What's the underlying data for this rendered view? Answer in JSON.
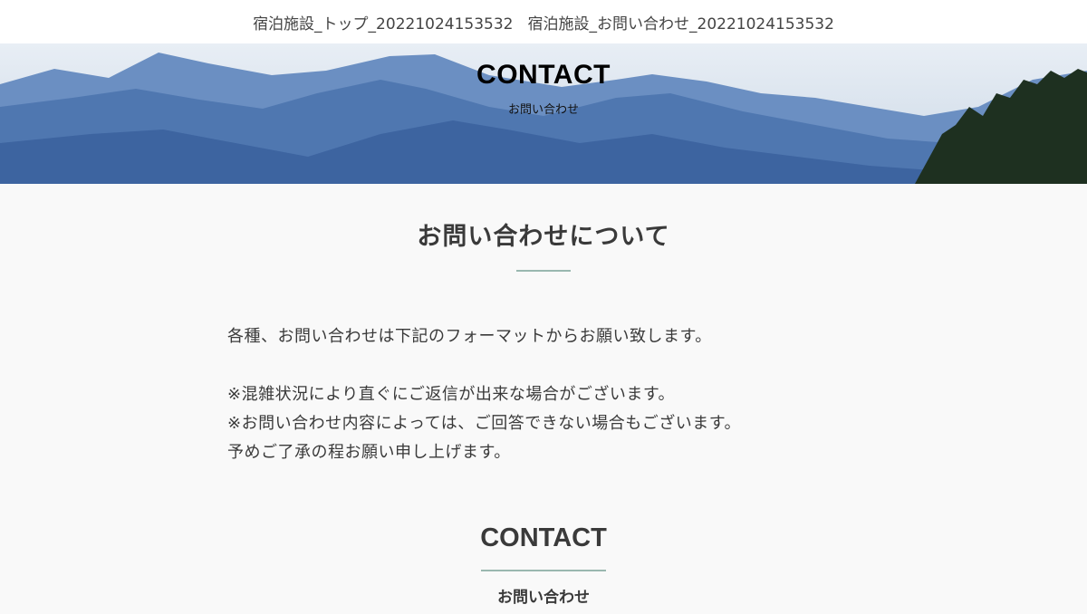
{
  "nav": {
    "items": [
      "宿泊施設_トップ_20221024153532",
      "宿泊施設_お問い合わせ_20221024153532"
    ]
  },
  "hero": {
    "title": "CONTACT",
    "subtitle": "お問い合わせ"
  },
  "about": {
    "title": "お問い合わせについて",
    "lines": [
      "各種、お問い合わせは下記のフォーマットからお願い致します。",
      "※混雑状況により直ぐにご返信が出来な場合がございます。",
      "※お問い合わせ内容によっては、ご回答できない場合もございます。",
      "予めご了承の程お願い申し上げます。"
    ]
  },
  "contact": {
    "title": "CONTACT",
    "subtitle": "お問い合わせ"
  }
}
